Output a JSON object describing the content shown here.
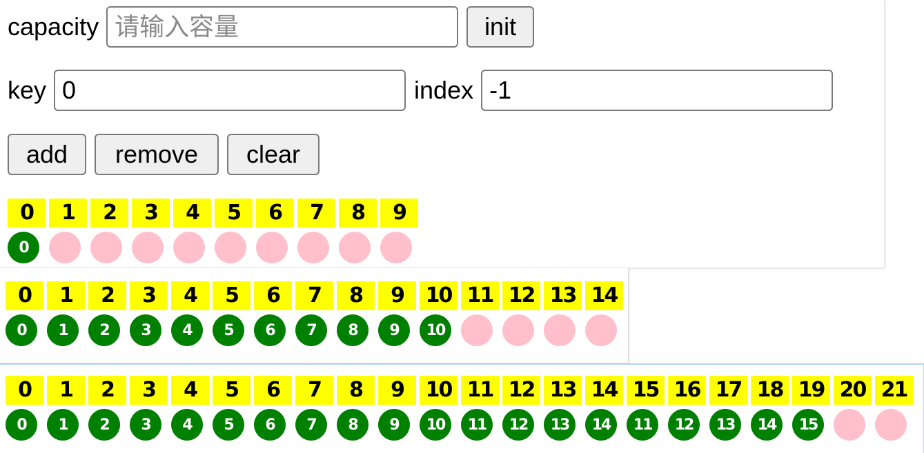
{
  "controls": {
    "capacity_label": "capacity",
    "capacity_placeholder": "请输入容量",
    "capacity_value": "",
    "init_label": "init",
    "key_label": "key",
    "key_value": "0",
    "index_label": "index",
    "index_value": "-1",
    "add_label": "add",
    "remove_label": "remove",
    "clear_label": "clear"
  },
  "colors": {
    "index_bg": "#ffff00",
    "filled": "#008000",
    "empty": "#ffc0cb"
  },
  "arrays": [
    {
      "indices": [
        "0",
        "1",
        "2",
        "3",
        "4",
        "5",
        "6",
        "7",
        "8",
        "9"
      ],
      "values": [
        "0",
        null,
        null,
        null,
        null,
        null,
        null,
        null,
        null,
        null
      ]
    },
    {
      "indices": [
        "0",
        "1",
        "2",
        "3",
        "4",
        "5",
        "6",
        "7",
        "8",
        "9",
        "10",
        "11",
        "12",
        "13",
        "14"
      ],
      "values": [
        "0",
        "1",
        "2",
        "3",
        "4",
        "5",
        "6",
        "7",
        "8",
        "9",
        "10",
        null,
        null,
        null,
        null
      ]
    },
    {
      "indices": [
        "0",
        "1",
        "2",
        "3",
        "4",
        "5",
        "6",
        "7",
        "8",
        "9",
        "10",
        "11",
        "12",
        "13",
        "14",
        "15",
        "16",
        "17",
        "18",
        "19",
        "20",
        "21"
      ],
      "values": [
        "0",
        "1",
        "2",
        "3",
        "4",
        "5",
        "6",
        "7",
        "8",
        "9",
        "10",
        "11",
        "12",
        "13",
        "14",
        "11",
        "12",
        "13",
        "14",
        "15",
        null,
        null
      ]
    }
  ]
}
